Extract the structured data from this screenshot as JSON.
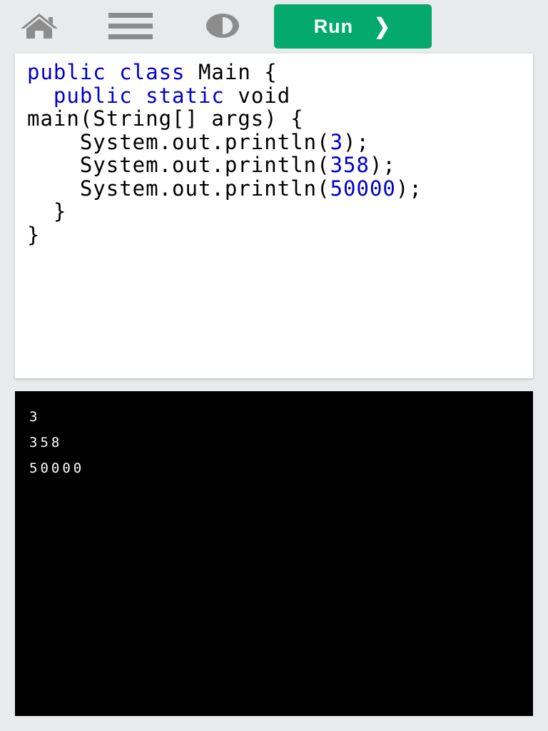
{
  "toolbar": {
    "icons": [
      "home-icon",
      "menu-icon",
      "contrast-icon"
    ],
    "run_label": "Run",
    "run_chevron": "❯",
    "run_color": "#04aa6d",
    "icon_color": "#8c8c8c"
  },
  "editor": {
    "lines": [
      [
        {
          "t": "public class",
          "k": "kw"
        },
        {
          "t": " Main {"
        }
      ],
      [
        {
          "t": "  "
        },
        {
          "t": "public static",
          "k": "kw"
        },
        {
          "t": " void"
        }
      ],
      [
        {
          "t": "main(String[] args) {"
        }
      ],
      [
        {
          "t": "    System.out.println("
        },
        {
          "t": "3",
          "k": "num"
        },
        {
          "t": ");"
        }
      ],
      [
        {
          "t": "    System.out.println("
        },
        {
          "t": "358",
          "k": "num"
        },
        {
          "t": ");"
        }
      ],
      [
        {
          "t": "    System.out.println("
        },
        {
          "t": "50000",
          "k": "num"
        },
        {
          "t": ");"
        }
      ],
      [
        {
          "t": "  }"
        }
      ],
      [
        {
          "t": "}"
        }
      ]
    ],
    "keyword_color": "#0000cd"
  },
  "console": {
    "output": [
      "3",
      "358",
      "50000"
    ]
  }
}
